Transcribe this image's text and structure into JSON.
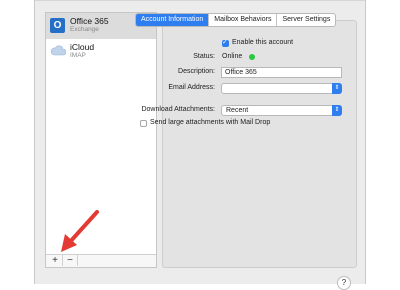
{
  "accounts": [
    {
      "name": "Office 365",
      "type": "Exchange",
      "icon": "office365-icon"
    },
    {
      "name": "iCloud",
      "type": "IMAP",
      "icon": "cloud-icon"
    }
  ],
  "sidebar_buttons": {
    "add": "+",
    "remove": "−"
  },
  "tabs": [
    {
      "label": "Account Information",
      "active": true
    },
    {
      "label": "Mailbox Behaviors",
      "active": false
    },
    {
      "label": "Server Settings",
      "active": false
    }
  ],
  "form": {
    "enable_label": "Enable this account",
    "enable_checked": true,
    "status_label": "Status:",
    "status_value": "Online",
    "status_color": "#28c840",
    "description_label": "Description:",
    "description_value": "Office 365",
    "email_label": "Email Address:",
    "email_value": "",
    "download_label": "Download Attachments:",
    "download_value": "Recent",
    "mail_drop_label": "Send large attachments with Mail Drop",
    "mail_drop_checked": false
  },
  "help": "?",
  "accent_color": "#2f7ef0",
  "annotation": {
    "arrow_color": "#e33b33"
  }
}
